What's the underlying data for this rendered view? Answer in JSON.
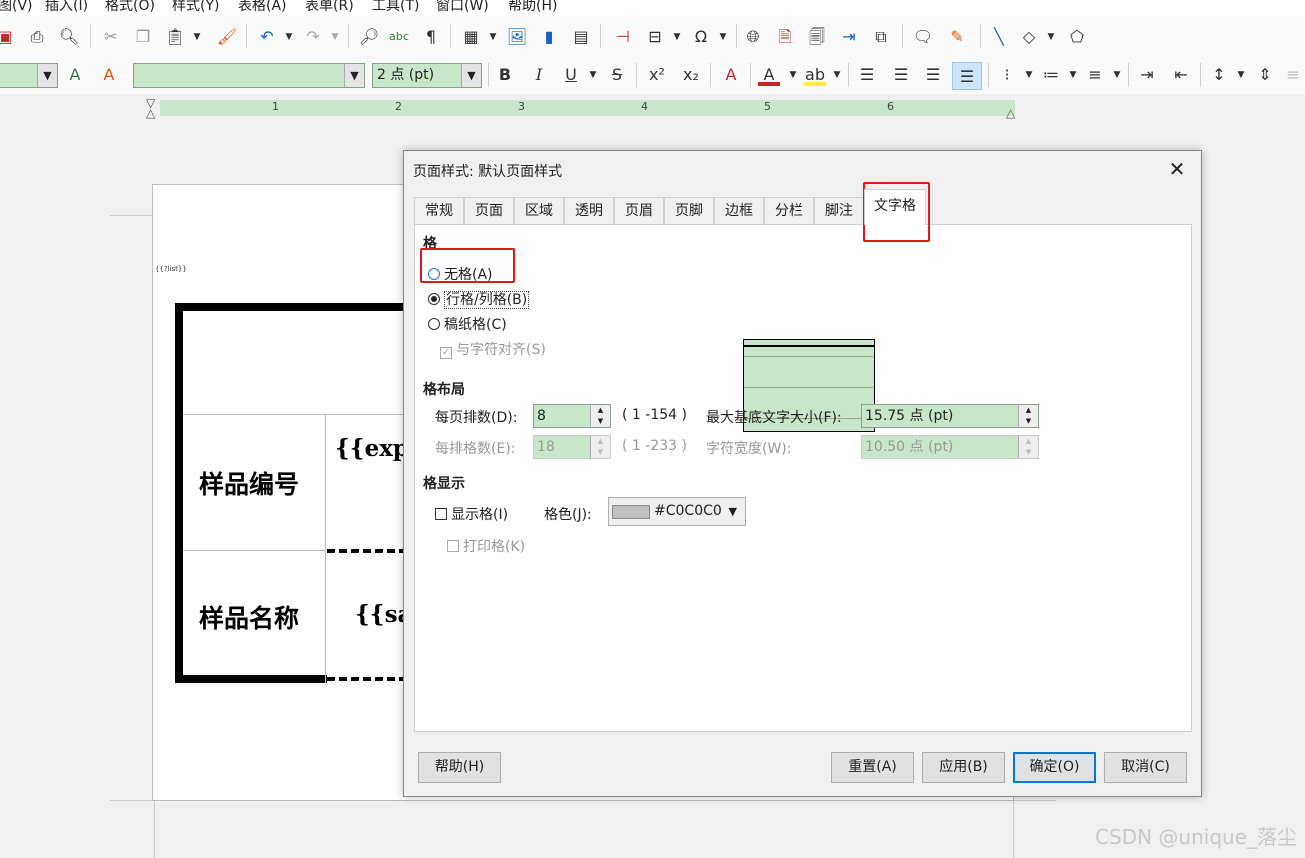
{
  "menubar": {
    "items": [
      "图(V)",
      "插入(I)",
      "格式(O)",
      "样式(Y)",
      "表格(A)",
      "表单(R)",
      "工具(T)",
      "窗口(W)",
      "帮助(H)"
    ]
  },
  "formatting": {
    "font_size_value": "2 点 (pt)"
  },
  "ruler": {
    "numbers": [
      "1",
      "2",
      "3",
      "4",
      "5",
      "6"
    ]
  },
  "document": {
    "small_field": "{{?list}}",
    "row1_label": "样品编号",
    "row1_field": "{{exp",
    "row2_label": "样品名称",
    "row2_field": "{{sa"
  },
  "dialog": {
    "title": "页面样式: 默认页面样式",
    "close_glyph": "✕",
    "tabs": [
      "常规",
      "页面",
      "区域",
      "透明",
      "页眉",
      "页脚",
      "边框",
      "分栏",
      "脚注",
      "文字格"
    ],
    "active_tab": "文字格",
    "grid": {
      "title": "格",
      "option_none": "无格(A)",
      "option_rows_cols": "行格/列格(B)",
      "option_manuscript": "稿纸格(C)",
      "snap_to_chars": "与字符对齐(S)",
      "selected": "行格/列格(B)"
    },
    "layout": {
      "title": "格布局",
      "lines_per_page_label": "每页排数(D):",
      "lines_per_page_value": "8",
      "lines_range": "( 1 -154 )",
      "max_base_text_label": "最大基底文字大小(F):",
      "max_base_text_value": "15.75 点 (pt)",
      "chars_per_line_label": "每排格数(E):",
      "chars_per_line_value": "18",
      "chars_range": "( 1 -233 )",
      "char_width_label": "字符宽度(W):",
      "char_width_value": "10.50 点 (pt)"
    },
    "display": {
      "title": "格显示",
      "show_grid": "显示格(I)",
      "color_label": "格色(J):",
      "color_value": "#C0C0C0",
      "print_grid": "打印格(K)"
    },
    "buttons": {
      "help": "帮助(H)",
      "reset": "重置(A)",
      "apply": "应用(B)",
      "ok": "确定(O)",
      "cancel": "取消(C)"
    }
  },
  "watermark": "CSDN @unique_落尘",
  "colors": {
    "accent_green": "#c8e6c9",
    "highlight_red": "#e01818",
    "default_button_border": "#0078d7",
    "grid_color": "#c0c0c0"
  }
}
